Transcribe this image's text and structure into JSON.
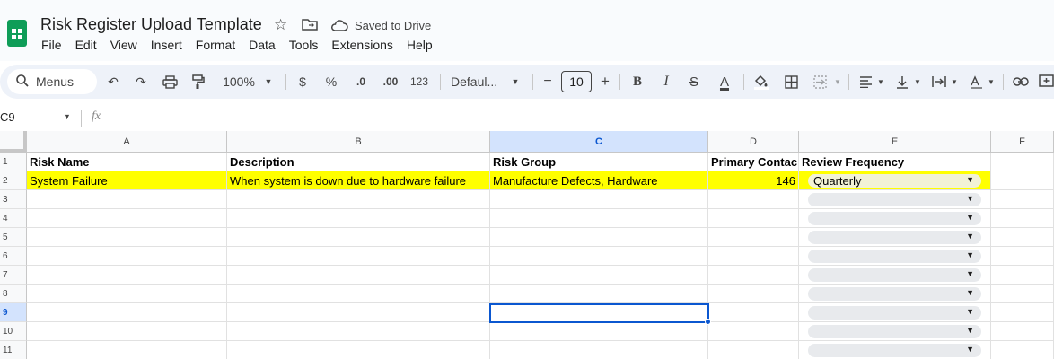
{
  "app": {
    "doc_title": "Risk Register Upload Template",
    "saved_status": "Saved to Drive",
    "menu": [
      "File",
      "Edit",
      "View",
      "Insert",
      "Format",
      "Data",
      "Tools",
      "Extensions",
      "Help"
    ]
  },
  "toolbar": {
    "search_label": "Menus",
    "zoom": "100%",
    "currency": "$",
    "percent": "%",
    "decrease_decimal": ".0",
    "increase_decimal": ".00",
    "number_format": "123",
    "font": "Defaul...",
    "font_size": "10",
    "minus": "−",
    "plus": "+",
    "bold": "B",
    "italic": "I",
    "strike": "S",
    "text_color": "A"
  },
  "formula_bar": {
    "name_box": "C9",
    "fx": "fx"
  },
  "grid": {
    "columns": [
      "A",
      "B",
      "C",
      "D",
      "E",
      "F"
    ],
    "selected_column": "C",
    "rows": [
      "1",
      "2",
      "3",
      "4",
      "5",
      "6",
      "7",
      "8",
      "9",
      "10",
      "11"
    ],
    "selected_row": "9",
    "header_row": [
      "Risk Name",
      "Description",
      "Risk Group",
      "Primary Contac",
      "Review Frequency"
    ],
    "data_row": {
      "risk_name": "System Failure",
      "description": "When system is down due to hardware failure",
      "risk_group": "Manufacture Defects, Hardware",
      "primary_contact": "146",
      "review_frequency": "Quarterly"
    },
    "highlight_color": "#ffff00",
    "selection_color": "#0b57d0"
  }
}
